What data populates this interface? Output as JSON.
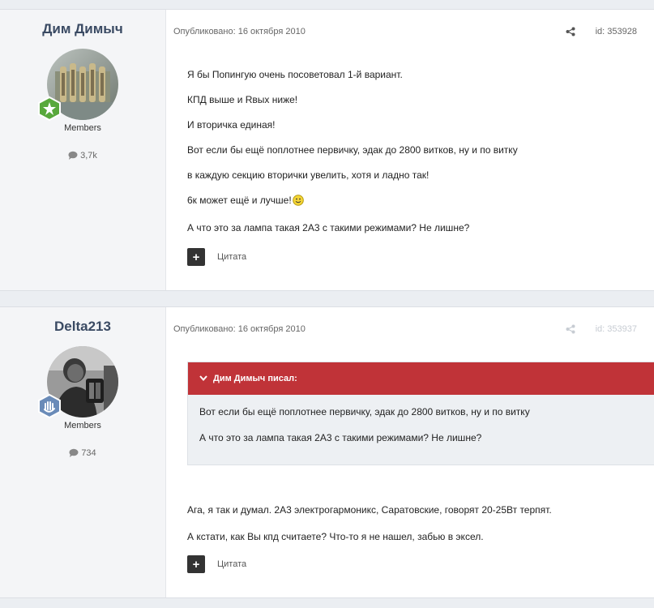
{
  "posts": [
    {
      "author": "Дим Димыч",
      "group": "Members",
      "post_count": "3,7k",
      "published": "Опубликовано: 16 октября 2010",
      "post_id": "id: 353928",
      "lines": [
        "Я бы Попингую очень посоветовал 1-й вариант.",
        "КПД выше и Rвых ниже!",
        "И вторичка единая!",
        "Вот если бы ещё поплотнее первичку, эдак до 2800 витков, ну и по витку",
        "в каждую секцию вторички увелить, хотя и ладно так!",
        "6к может ещё и лучше!",
        "А что это за лампа такая 2А3 с такими режимами? Не лишне?"
      ],
      "quote_label": "Цитата"
    },
    {
      "author": "Delta213",
      "group": "Members",
      "post_count": "734",
      "published": "Опубликовано: 16 октября 2010",
      "post_id": "id: 353937",
      "quote": {
        "header": "Дим Димыч писал:",
        "lines": [
          "Вот если бы ещё поплотнее первичку, эдак до 2800 витков, ну и по витку",
          "А что это за лампа такая 2А3 с такими режимами? Не лишне?"
        ]
      },
      "lines": [
        "Ага, я так и думал. 2А3 электрогармоникс, Саратовские, говорят 20-25Вт терпят.",
        "А кстати, как Вы кпд считаете? Что-то я не нашел, забью в эксел."
      ],
      "quote_label": "Цитата"
    }
  ],
  "icons": {
    "comment": "comment-icon",
    "share": "share-icon",
    "badge_1": "star-badge-icon",
    "badge_2": "hand-badge-icon",
    "smiley": "smiley-icon",
    "chevron": "chevron-down-icon"
  },
  "colors": {
    "quote_header": "#c03338",
    "author_name": "#3a4a63",
    "badge_green": "#58a83c",
    "badge_blue": "#6a8bb8"
  }
}
